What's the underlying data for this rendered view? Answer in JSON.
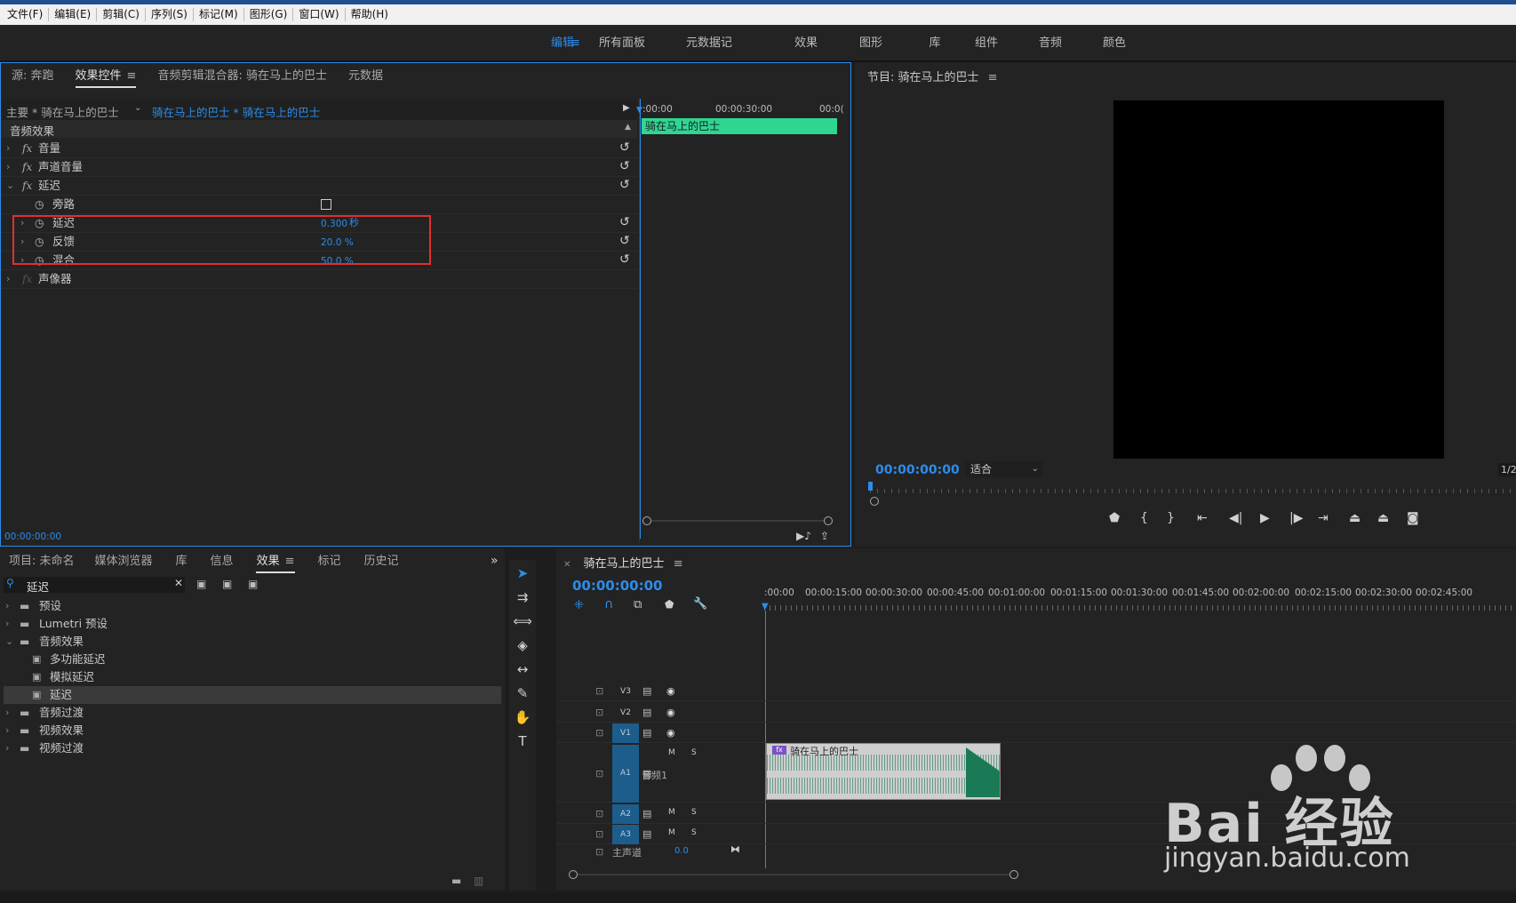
{
  "menubar": {
    "items": [
      "文件(F)",
      "编辑(E)",
      "剪辑(C)",
      "序列(S)",
      "标记(M)",
      "图形(G)",
      "窗口(W)",
      "帮助(H)"
    ]
  },
  "workspaces": {
    "items": [
      "编辑",
      "所有面板",
      "元数据记录",
      "效果",
      "图形",
      "库",
      "组件",
      "音频",
      "颜色"
    ],
    "active": "编辑"
  },
  "effect_controls": {
    "tabs": [
      "源: 奔跑",
      "效果控件",
      "音频剪辑混合器: 骑在马上的巴士",
      "元数据"
    ],
    "active_tab": "效果控件",
    "master_label": "主要 * 骑在马上的巴士",
    "clip_label": "骑在马上的巴士 * 骑在马上的巴士",
    "section": "音频效果",
    "effects": [
      {
        "name": "音量"
      },
      {
        "name": "声道音量"
      },
      {
        "name": "延迟"
      },
      {
        "name": "声像器"
      }
    ],
    "params": [
      {
        "name": "旁路",
        "value": ""
      },
      {
        "name": "延迟",
        "value": "0.300",
        "unit": "秒"
      },
      {
        "name": "反馈",
        "value": "20.0 %",
        "unit": ""
      },
      {
        "name": "混合",
        "value": "50.0 %",
        "unit": ""
      }
    ],
    "mini_timeline": {
      "ticks": [
        ":00:00",
        "00:00:30:00",
        "00:0("
      ],
      "clip_name": "骑在马上的巴士"
    },
    "timecode": "00:00:00:00"
  },
  "program": {
    "title": "节目: 骑在马上的巴士",
    "timecode": "00:00:00:00",
    "fit": "适合",
    "fraction": "1/2"
  },
  "project": {
    "tabs": [
      "项目: 未命名",
      "媒体浏览器",
      "库",
      "信息",
      "效果",
      "标记",
      "历史记"
    ],
    "active_tab": "效果",
    "search_value": "延迟",
    "tree": [
      {
        "label": "预设",
        "level": 0
      },
      {
        "label": "Lumetri 预设",
        "level": 0
      },
      {
        "label": "音频效果",
        "level": 0
      },
      {
        "label": "多功能延迟",
        "level": 1
      },
      {
        "label": "模拟延迟",
        "level": 1
      },
      {
        "label": "延迟",
        "level": 1,
        "selected": true
      },
      {
        "label": "音频过渡",
        "level": 0
      },
      {
        "label": "视频效果",
        "level": 0
      },
      {
        "label": "视频过渡",
        "level": 0
      }
    ]
  },
  "timeline": {
    "title": "骑在马上的巴士",
    "timecode": "00:00:00:00",
    "ruler": [
      ":00:00",
      "00:00:15:00",
      "00:00:30:00",
      "00:00:45:00",
      "00:01:00:00",
      "00:01:15:00",
      "00:01:30:00",
      "00:01:45:00",
      "00:02:00:00",
      "00:02:15:00",
      "00:02:30:00",
      "00:02:45:00"
    ],
    "tracks": [
      {
        "id": "V3",
        "type": "video"
      },
      {
        "id": "V2",
        "type": "video"
      },
      {
        "id": "V1",
        "type": "video"
      },
      {
        "id": "A1",
        "type": "audio",
        "name": "音频1"
      },
      {
        "id": "A2",
        "type": "audio"
      },
      {
        "id": "A3",
        "type": "audio"
      }
    ],
    "master": {
      "label": "主声道",
      "value": "0.0"
    },
    "clip_name": "骑在马上的巴士",
    "mute": "M",
    "solo": "S"
  },
  "watermark": {
    "brand": "Bai 经验",
    "url": "jingyan.baidu.com"
  }
}
